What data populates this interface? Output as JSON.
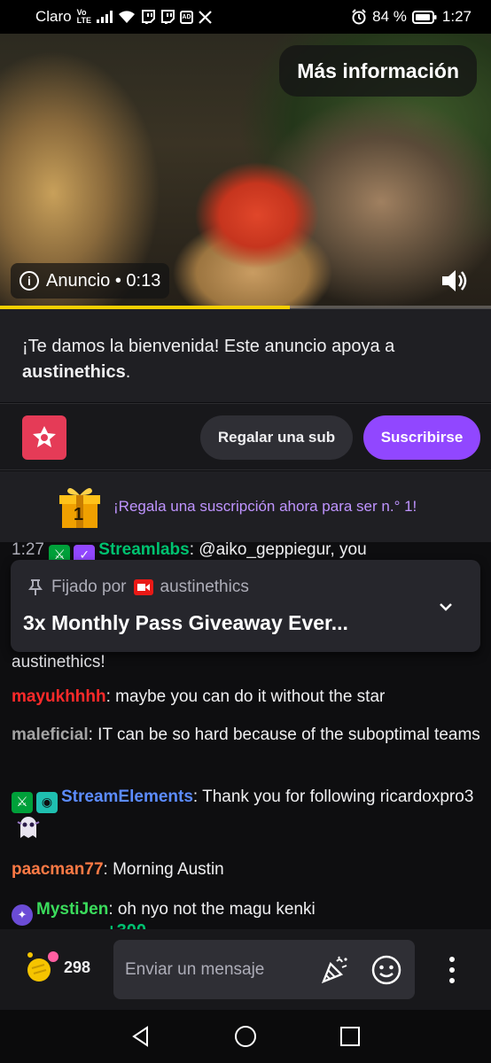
{
  "status_bar": {
    "carrier": "Claro",
    "volte_top": "Vo",
    "volte_bottom": "LTE",
    "battery": "84 %",
    "time": "1:27",
    "icons": [
      "signal-icon",
      "wifi-icon",
      "twitch-icon",
      "twitch-icon",
      "ad-icon",
      "x-icon",
      "alarm-icon",
      "battery-icon"
    ]
  },
  "video": {
    "more_info_label": "Más información",
    "ad_label": "Anuncio • 0:13",
    "progress_percent": 59
  },
  "welcome": {
    "text": "¡Te damos la bienvenida! Este anuncio apoya a",
    "channel": "austinethics",
    "suffix": "."
  },
  "actions": {
    "gift_sub_label": "Regalar una sub",
    "subscribe_label": "Suscribirse"
  },
  "gift_promo": {
    "text": "¡Regala una suscripción ahora para ser n.° 1!",
    "rank": "1"
  },
  "chat": {
    "partial_top": {
      "time": "1:27",
      "user": "Streamlabs",
      "text": ": @aiko_geppiegur, you",
      "user_color": "#00c270"
    },
    "pinned": {
      "label": "Fijado por",
      "user": "austinethics",
      "title": "3x Monthly Pass Giveaway Ever..."
    },
    "partial_after_pin": "austinethics!",
    "messages": [
      {
        "user": "mayukhhhh",
        "text": ": maybe you can do it without the star",
        "color": "#ff2a2a"
      },
      {
        "user": "maleficial",
        "text": ": IT can be so hard because of the suboptimal teams",
        "color": "#a4a4a4"
      },
      {
        "user": "StreamElements",
        "text": ": Thank you for following ricardoxpro3",
        "color": "#5c8cff"
      },
      {
        "user": "paacman77",
        "text": ": Morning Austin",
        "color": "#ff7a45"
      },
      {
        "user": "MystiJen",
        "text": ": oh nyo not the magu kenki",
        "color": "#3bdc5c"
      }
    ],
    "partial_bottom": "+300"
  },
  "input_bar": {
    "bits_count": "298",
    "placeholder": "Enviar un mensaje"
  }
}
